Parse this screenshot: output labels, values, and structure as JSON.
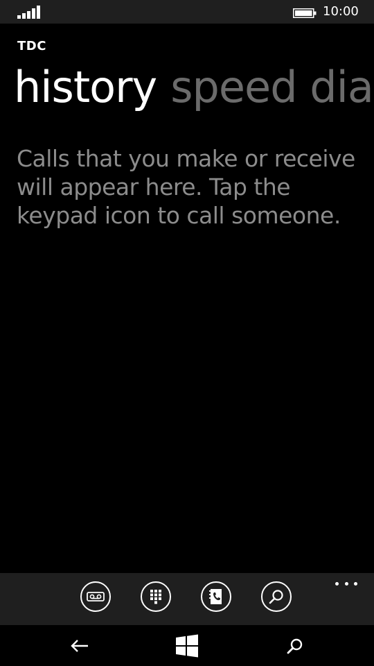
{
  "status_bar": {
    "time": "10:00",
    "signal_icon": "signal-strength-icon",
    "battery_icon": "battery-icon"
  },
  "app": {
    "carrier": "TDC",
    "pivot": {
      "active": "history",
      "next": "speed dial"
    },
    "empty_message": "Calls that you make or receive will appear here. Tap the keypad icon to call someone."
  },
  "app_bar": {
    "buttons": [
      {
        "icon": "voicemail-icon"
      },
      {
        "icon": "keypad-icon"
      },
      {
        "icon": "phonebook-icon"
      },
      {
        "icon": "search-icon"
      }
    ],
    "more_icon": "more-options-icon"
  },
  "nav_bar": {
    "back_icon": "back-arrow-icon",
    "start_icon": "windows-start-icon",
    "search_icon": "search-icon"
  },
  "colors": {
    "background": "#000000",
    "bar_background": "#1f1f1f",
    "inactive_pivot": "#6b6b6b",
    "message_text": "#8c8c8c"
  }
}
